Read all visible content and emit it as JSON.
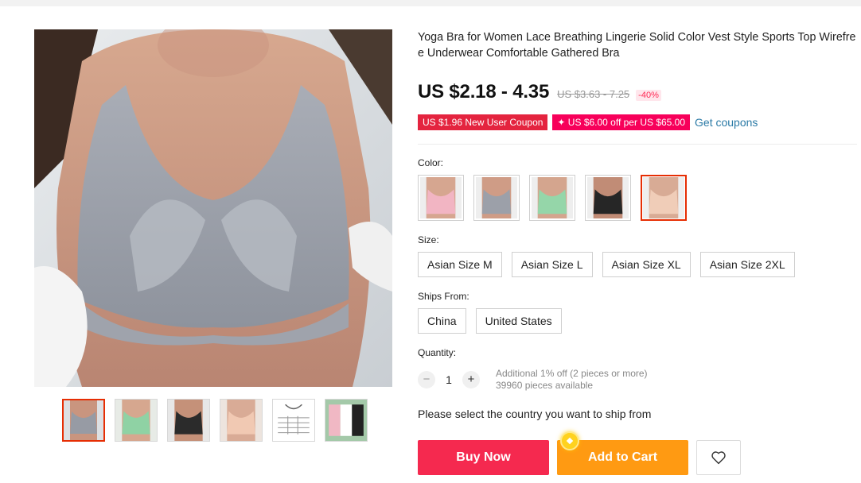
{
  "product": {
    "title": "Yoga Bra for Women Lace Breathing Lingerie Solid Color Vest Style Sports Top Wirefree Underwear Comfortable Gathered Bra",
    "price": "US $2.18 - 4.35",
    "original_price": "US $3.63 - 7.25",
    "discount": "-40%"
  },
  "coupons": {
    "new_user": "US $1.96 New User Coupon",
    "store": "✦ US $6.00 off per US $65.00",
    "get_link": "Get coupons"
  },
  "color": {
    "label": "Color:",
    "options": [
      "pink",
      "gray",
      "green",
      "black",
      "nude"
    ],
    "selected_index": 4
  },
  "size": {
    "label": "Size:",
    "options": [
      "Asian Size M",
      "Asian Size L",
      "Asian Size XL",
      "Asian Size 2XL"
    ]
  },
  "ships_from": {
    "label": "Ships From:",
    "options": [
      "China",
      "United States"
    ]
  },
  "quantity": {
    "label": "Quantity:",
    "value": "1",
    "minus": "−",
    "plus": "+",
    "offer": "Additional 1% off (2 pieces or more)",
    "available": "39960 pieces available"
  },
  "ship_note": "Please select the country you want to ship from",
  "actions": {
    "buy_now": "Buy Now",
    "add_to_cart": "Add to Cart",
    "wishlist_icon": "heart-icon"
  },
  "colors": {
    "buy_now": "#f5294f",
    "add_to_cart": "#ff9a12",
    "selected_border": "#e62e04",
    "coupon_red": "#e4243f",
    "coupon_pink": "#f7005a",
    "link": "#2b7aa6"
  }
}
